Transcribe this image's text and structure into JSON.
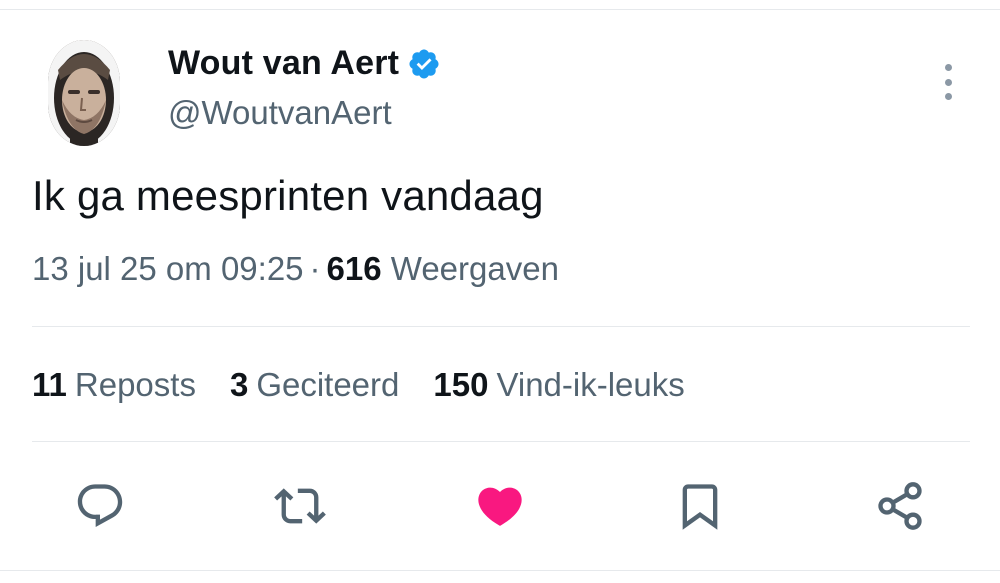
{
  "author": {
    "name": "Wout van Aert",
    "handle": "@WoutvanAert",
    "verified_icon": "verified-badge-icon",
    "avatar": "profile-photo"
  },
  "tweet": {
    "text": "Ik ga meesprinten vandaag",
    "timestamp": "13 jul 25 om 09:25",
    "separator": "·",
    "views_count": "616",
    "views_label": "Weergaven"
  },
  "stats": {
    "reposts_count": "11",
    "reposts_label": "Reposts",
    "quotes_count": "3",
    "quotes_label": "Geciteerd",
    "likes_count": "150",
    "likes_label": "Vind-ik-leuks"
  },
  "actions": [
    "reply-icon",
    "repost-icon",
    "like-icon",
    "bookmark-icon",
    "share-icon"
  ],
  "colors": {
    "text": "#0f1419",
    "secondary": "#536471",
    "verified": "#1d9bf0",
    "like_active": "#f91880",
    "icon": "#536471"
  }
}
